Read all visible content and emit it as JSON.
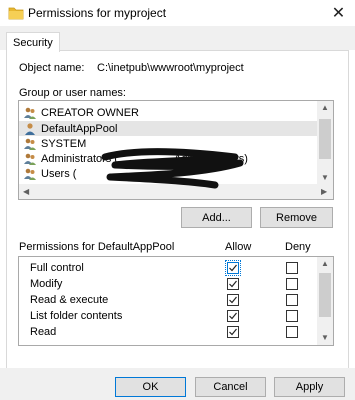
{
  "window": {
    "title": "Permissions for myproject",
    "close_glyph": "✕"
  },
  "tabs": [
    {
      "label": "Security"
    }
  ],
  "object": {
    "label": "Object name:",
    "value": "C:\\inetpub\\wwwroot\\myproject"
  },
  "group_label": "Group or user names:",
  "users": [
    {
      "name": "CREATOR OWNER",
      "icon": "group-icon",
      "selected": false
    },
    {
      "name": "DefaultAppPool",
      "icon": "user-icon",
      "selected": true
    },
    {
      "name": "SYSTEM",
      "icon": "group-icon",
      "selected": false
    },
    {
      "name": "Administrators (",
      "suffix": "Administrators)",
      "icon": "group-icon",
      "selected": false
    },
    {
      "name": "Users (",
      "icon": "group-icon",
      "selected": false
    }
  ],
  "buttons": {
    "add": "Add...",
    "remove": "Remove",
    "ok": "OK",
    "cancel": "Cancel",
    "apply": "Apply"
  },
  "permissions": {
    "header": "Permissions for DefaultAppPool",
    "allow_label": "Allow",
    "deny_label": "Deny",
    "rows": [
      {
        "name": "Full control",
        "allow": true,
        "deny": false
      },
      {
        "name": "Modify",
        "allow": true,
        "deny": false
      },
      {
        "name": "Read & execute",
        "allow": true,
        "deny": false
      },
      {
        "name": "List folder contents",
        "allow": true,
        "deny": false
      },
      {
        "name": "Read",
        "allow": true,
        "deny": false
      }
    ]
  },
  "colors": {
    "accent": "#0078d7",
    "selection": "#e5e5e5",
    "folder": "#e8b730"
  }
}
